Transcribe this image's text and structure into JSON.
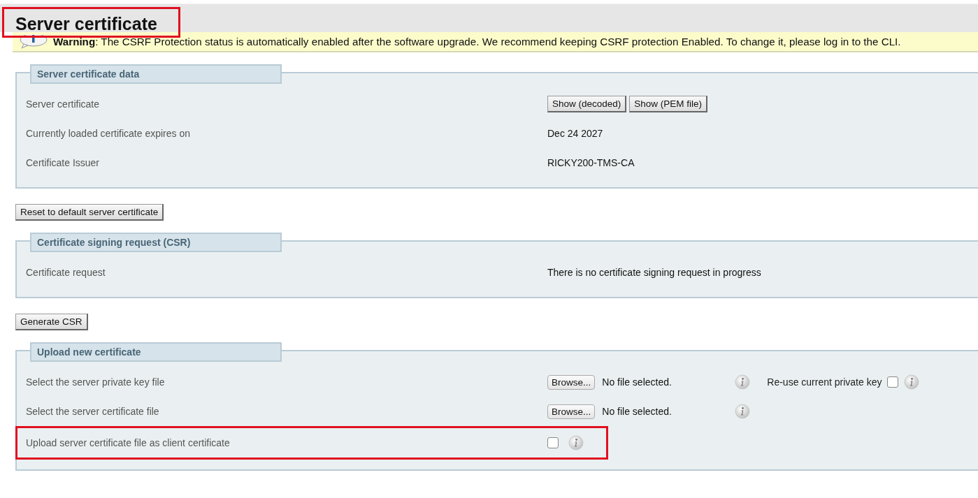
{
  "page": {
    "title": "Server certificate",
    "title_highlighted": true
  },
  "warning": {
    "text": "**Warning**: The CSRF Protection status is automatically enabled after the software upgrade. We recommend keeping CSRF protection Enabled. To change it, please log in to the CLI."
  },
  "sections": [
    {
      "legend": "Server certificate data",
      "rows": [
        {
          "kind": "buttons",
          "label": "Server certificate",
          "buttons": [
            "Show (decoded)",
            "Show (PEM file)"
          ],
          "highlighted": false
        },
        {
          "kind": "text",
          "label": "Currently loaded certificate expires on",
          "value": "Dec 24 2027",
          "highlighted": false
        },
        {
          "kind": "text",
          "label": "Certificate Issuer",
          "value": "RICKY200-TMS-CA",
          "highlighted": false
        }
      ],
      "action": "Reset to default server certificate"
    },
    {
      "legend": "Certificate signing request (CSR)",
      "rows": [
        {
          "kind": "text",
          "label": "Certificate request",
          "value": "There is no certificate signing request in progress",
          "highlighted": false
        }
      ],
      "action": "Generate CSR"
    },
    {
      "legend": "Upload new certificate",
      "rows": [
        {
          "kind": "file",
          "label": "Select the server private key file",
          "browse": "Browse...",
          "file_status": "No file selected.",
          "extra": {
            "label": "Re-use current private key",
            "checked": false
          },
          "highlighted": false
        },
        {
          "kind": "file",
          "label": "Select the server certificate file",
          "browse": "Browse...",
          "file_status": "No file selected.",
          "highlighted": false
        },
        {
          "kind": "checkbox",
          "label": "Upload server certificate file as client certificate",
          "checked": false,
          "highlighted": true
        }
      ]
    }
  ]
}
